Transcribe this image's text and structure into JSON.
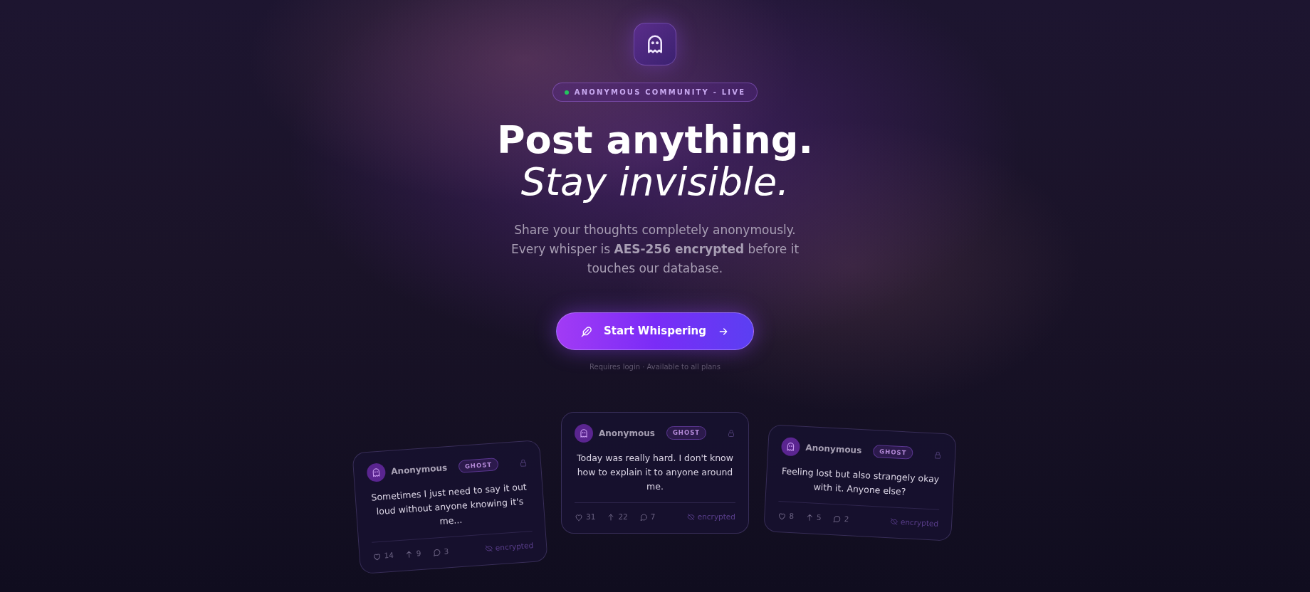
{
  "hero": {
    "badge": {
      "label": "ANONYMOUS COMMUNITY - LIVE",
      "live": true
    },
    "heading": "**Post anything.** *Stay invisible.*",
    "description": "Share your thoughts completely anonymously. Every whisper is **AES-256 encrypted** before it touches our database.",
    "cta": {
      "label": "Start Whispering"
    },
    "caption": "Requires login · Available to all plans"
  },
  "posts": [
    {
      "author": "Anonymous",
      "badge": "GHOST",
      "text": "Sometimes I just need to say it out loud without anyone knowing it's me...",
      "likes": "14",
      "boosts": "9",
      "comments": "3",
      "status": "encrypted"
    },
    {
      "author": "Anonymous",
      "badge": "GHOST",
      "text": "Today was really hard. I don't know how to explain it to anyone around me.",
      "likes": "31",
      "boosts": "22",
      "comments": "7",
      "status": "encrypted"
    },
    {
      "author": "Anonymous",
      "badge": "GHOST",
      "text": "Feeling lost but also strangely okay with it. Anyone else?",
      "likes": "8",
      "boosts": "5",
      "comments": "2",
      "status": "encrypted"
    }
  ]
}
